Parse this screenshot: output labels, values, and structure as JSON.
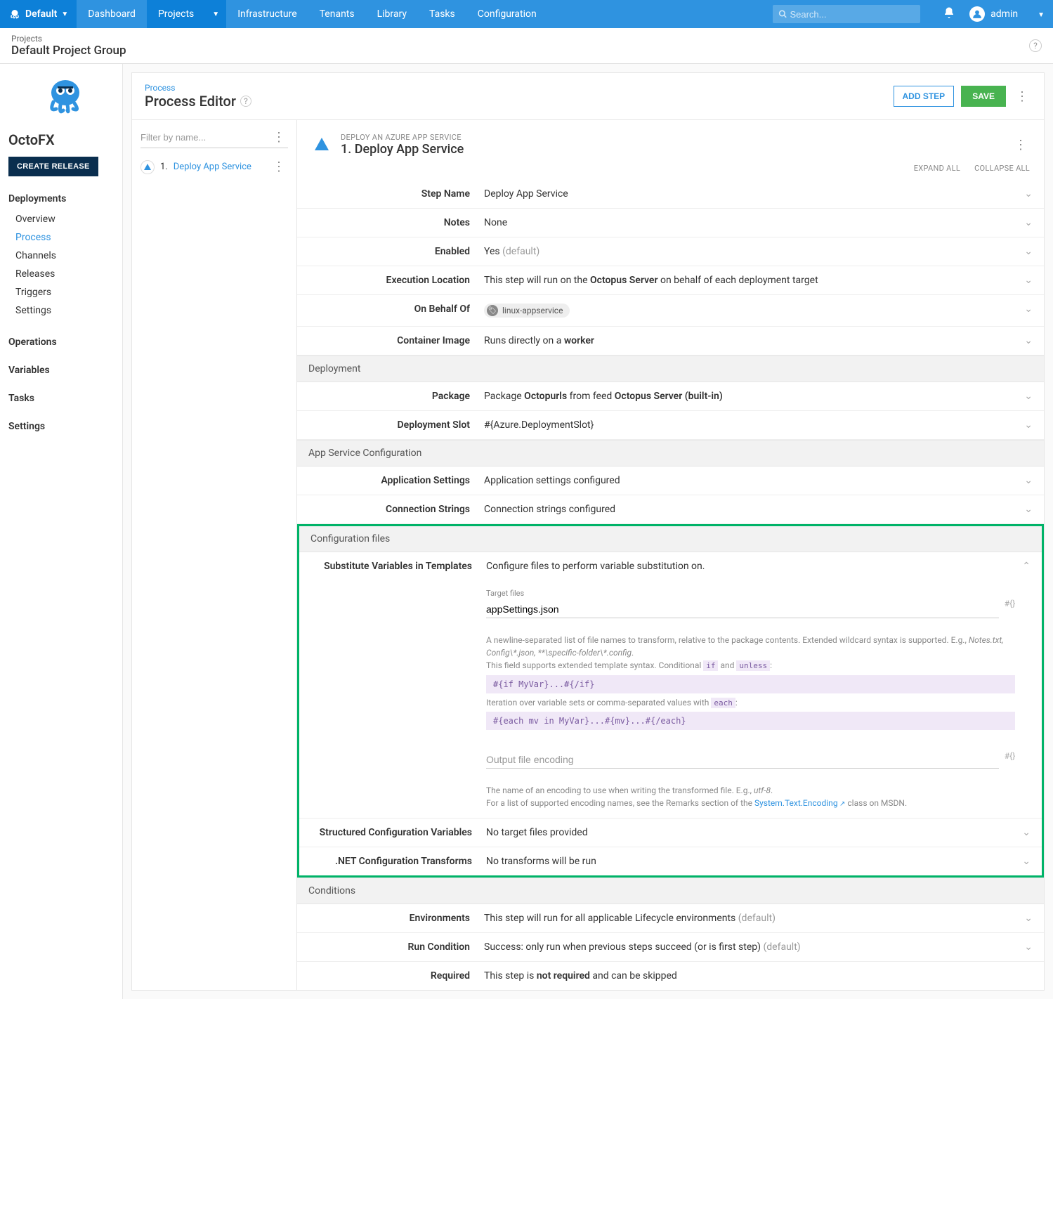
{
  "topnav": {
    "brand": "Default",
    "items": [
      "Dashboard",
      "Projects",
      "Infrastructure",
      "Tenants",
      "Library",
      "Tasks",
      "Configuration"
    ],
    "active_index": 1,
    "search_placeholder": "Search...",
    "user": "admin"
  },
  "breadcrumb": {
    "parent": "Projects",
    "title": "Default Project Group"
  },
  "sidebar": {
    "project_name": "OctoFX",
    "create_button": "CREATE RELEASE",
    "groups": [
      {
        "head": "Deployments",
        "items": [
          "Overview",
          "Process",
          "Channels",
          "Releases",
          "Triggers",
          "Settings"
        ],
        "active": "Process"
      },
      {
        "head": "Operations",
        "items": []
      },
      {
        "head": "Variables",
        "items": []
      },
      {
        "head": "Tasks",
        "items": []
      },
      {
        "head": "Settings",
        "items": []
      }
    ]
  },
  "editor": {
    "sub": "Process",
    "title": "Process Editor",
    "add_step": "ADD STEP",
    "save": "SAVE",
    "filter_placeholder": "Filter by name...",
    "step_list": [
      {
        "num": "1.",
        "name": "Deploy App Service"
      }
    ],
    "expand_all": "EXPAND ALL",
    "collapse_all": "COLLAPSE ALL",
    "detail_meta": "DEPLOY AN AZURE APP SERVICE",
    "detail_title": "1. Deploy App Service",
    "rows": {
      "step_name": {
        "label": "Step Name",
        "value": "Deploy App Service"
      },
      "notes": {
        "label": "Notes",
        "value": "None"
      },
      "enabled": {
        "label": "Enabled",
        "value_main": "Yes",
        "value_suffix": " (default)"
      },
      "exec_location": {
        "label": "Execution Location",
        "prefix": "This step will run on the ",
        "bold": "Octopus Server",
        "suffix": " on behalf of each deployment target"
      },
      "on_behalf": {
        "label": "On Behalf Of",
        "tag": "linux-appservice"
      },
      "container": {
        "label": "Container Image",
        "prefix": "Runs directly on a ",
        "bold": "worker"
      },
      "deployment_hdr": "Deployment",
      "package": {
        "label": "Package",
        "prefix": "Package ",
        "bold1": "Octopurls",
        "mid": " from feed ",
        "bold2": "Octopus Server (built-in)"
      },
      "slot": {
        "label": "Deployment Slot",
        "value": "#{Azure.DeploymentSlot}"
      },
      "appsvc_hdr": "App Service Configuration",
      "app_settings": {
        "label": "Application Settings",
        "value": "Application settings configured"
      },
      "conn_strings": {
        "label": "Connection Strings",
        "value": "Connection strings configured"
      },
      "config_files_hdr": "Configuration files",
      "subst_vars": {
        "label": "Substitute Variables in Templates",
        "desc": "Configure files to perform variable substitution on.",
        "target_files_label": "Target files",
        "target_files_value": "appSettings.json",
        "var_token": "#{}",
        "help1a": "A newline-separated list of file names to transform, relative to the package contents. Extended wildcard syntax is supported. E.g., ",
        "help1b": "Notes.txt, Config\\*.json, **\\specific-folder\\*.config",
        "help1c": ".",
        "help2a": "This field supports extended template syntax. Conditional ",
        "help2_if": "if",
        "help2b": " and ",
        "help2_unless": "unless",
        "help2c": ":",
        "code1": "#{if MyVar}...#{/if}",
        "help3a": "Iteration over variable sets or comma-separated values with ",
        "help3_each": "each",
        "help3b": ":",
        "code2": "#{each mv in MyVar}...#{mv}...#{/each}",
        "encoding_placeholder": "Output file encoding",
        "enc_help1a": "The name of an encoding to use when writing the transformed file. E.g., ",
        "enc_help1b": "utf-8",
        "enc_help1c": ".",
        "enc_help2a": "For a list of supported encoding names, see the Remarks section of the ",
        "enc_link": "System.Text.Encoding",
        "enc_help2b": " class on MSDN."
      },
      "struct_vars": {
        "label": "Structured Configuration Variables",
        "value": "No target files provided"
      },
      "net_transforms": {
        "label": ".NET Configuration Transforms",
        "value": "No transforms will be run"
      },
      "conditions_hdr": "Conditions",
      "environments": {
        "label": "Environments",
        "main": "This step will run for all applicable Lifecycle environments",
        "suffix": " (default)"
      },
      "run_cond": {
        "label": "Run Condition",
        "main": "Success: only run when previous steps succeed (or is first step)",
        "suffix": " (default)"
      },
      "required": {
        "label": "Required",
        "prefix": "This step is ",
        "bold": "not required",
        "suffix": " and can be skipped"
      }
    }
  }
}
